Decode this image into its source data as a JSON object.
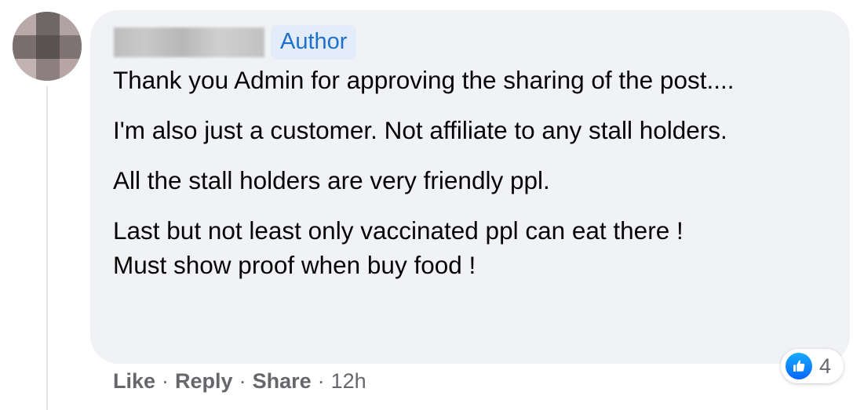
{
  "comment": {
    "author_badge": "Author",
    "paragraphs": [
      "Thank you Admin for approving the sharing of the post....",
      "I'm also just a customer. Not affiliate to any stall holders.",
      "All the stall holders are very friendly ppl.",
      "Last but not least only vaccinated ppl can eat there !"
    ],
    "last_line": "Must show proof when buy food !"
  },
  "actions": {
    "like_label": "Like",
    "reply_label": "Reply",
    "share_label": "Share",
    "separator": "·",
    "timestamp": "12h"
  },
  "reactions": {
    "icon": "thumbs-up-icon",
    "count": "4",
    "color": "#1877f2"
  },
  "colors": {
    "bubble_bg": "#f0f2f5",
    "badge_bg": "#e3edf9",
    "badge_text": "#1f6fcc",
    "meta_text": "#65676b"
  }
}
